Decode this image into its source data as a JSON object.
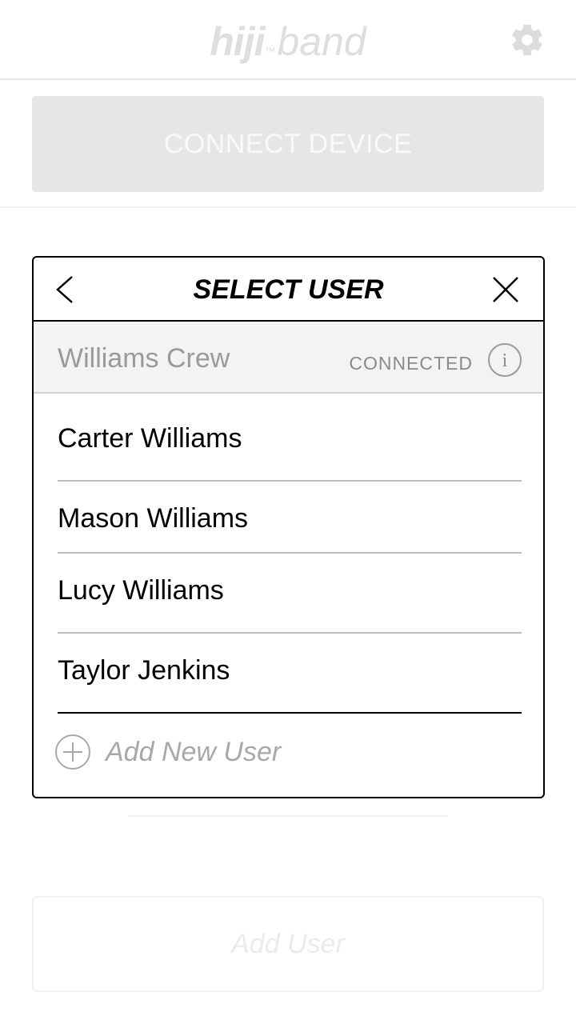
{
  "header": {
    "logo_main": "hiji",
    "logo_tm": "™",
    "logo_sub": "band"
  },
  "connect_button": {
    "label": "CONNECT DEVICE"
  },
  "background": {
    "add_user_label": "Add User"
  },
  "modal": {
    "title": "SELECT USER",
    "group": {
      "name": "Williams Crew",
      "status": "CONNECTED"
    },
    "users": [
      {
        "name": "Carter Williams"
      },
      {
        "name": "Mason Williams"
      },
      {
        "name": "Lucy Williams"
      },
      {
        "name": "Taylor Jenkins"
      }
    ],
    "add_new_user_label": "Add New User"
  }
}
